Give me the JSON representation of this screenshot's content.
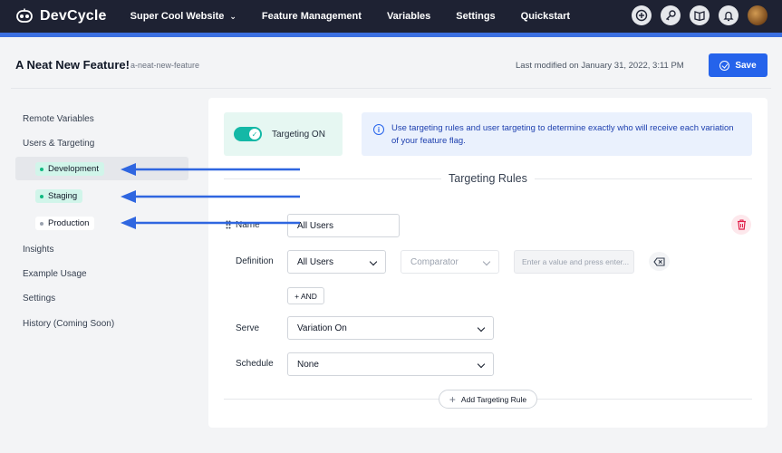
{
  "app": {
    "brand": "DevCycle"
  },
  "nav": {
    "project": "Super Cool Website",
    "links": [
      "Feature Management",
      "Variables",
      "Settings",
      "Quickstart"
    ],
    "icons": [
      "plus-circle-icon",
      "key-icon",
      "book-icon",
      "bell-icon",
      "avatar"
    ]
  },
  "feature": {
    "name": "A Neat New Feature!",
    "key": "a-neat-new-feature",
    "last_modified": "Last modified on January 31, 2022, 3:11 PM",
    "save_label": "Save"
  },
  "sidebar": {
    "items_top": [
      "Remote Variables",
      "Users & Targeting"
    ],
    "environments": [
      {
        "label": "Development",
        "dot": "#10b981",
        "bg": "#d1f5ea",
        "active": true
      },
      {
        "label": "Staging",
        "dot": "#10b981",
        "bg": "#d1f5ea",
        "active": false
      },
      {
        "label": "Production",
        "dot": "#9ca3af",
        "bg": "#ffffff",
        "active": false
      }
    ],
    "items_bottom": [
      "Insights",
      "Example Usage",
      "Settings",
      "History (Coming Soon)"
    ]
  },
  "targeting": {
    "toggle_label": "Targeting ON",
    "toggle_on": true,
    "info_text": "Use targeting rules and user targeting to determine exactly who will receive each variation of your feature flag.",
    "rules_title": "Targeting Rules",
    "rule": {
      "name_label": "Name",
      "name_value": "All Users",
      "definition_label": "Definition",
      "definition_value": "All Users",
      "comparator_placeholder": "Comparator",
      "value_placeholder": "Enter a value and press enter...",
      "and_label": "+ AND",
      "serve_label": "Serve",
      "serve_value": "Variation On",
      "schedule_label": "Schedule",
      "schedule_value": "None"
    },
    "add_rule_label": "Add Targeting Rule"
  },
  "colors": {
    "nav_bg": "#1e2233",
    "accent": "#2563eb",
    "toggle": "#14b8a6",
    "arrow": "#2f66e0"
  }
}
